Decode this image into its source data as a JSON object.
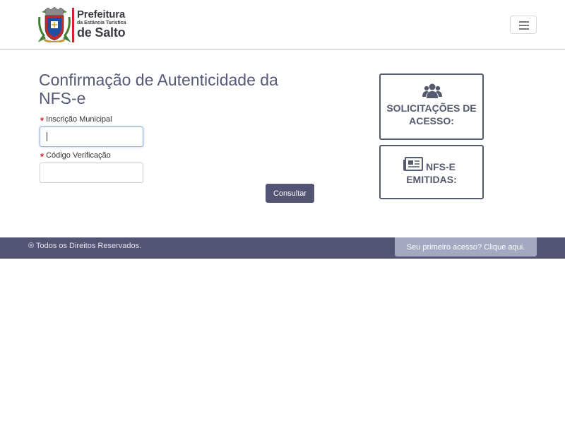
{
  "header": {
    "logo": {
      "line1": "Prefeitura",
      "line2": "da Estância Turística",
      "line3": "de Salto"
    },
    "menu_icon": "hamburger-menu-icon"
  },
  "main": {
    "title": "Confirmação de Autenticidade da NFS-e",
    "required_mark": "*",
    "inscricao": {
      "label": "Inscrição Municipal",
      "value": ""
    },
    "codigo": {
      "label": "Código Verificação",
      "value": ""
    },
    "submit_label": "Consultar"
  },
  "tiles": {
    "solicitacoes": {
      "icon": "users-icon",
      "label": "SOLICITAÇÕES DE ACESSO:"
    },
    "nfse": {
      "icon": "newspaper-icon",
      "label_part1": "NFS-E",
      "label_part2": "EMITIDAS:"
    }
  },
  "footer": {
    "copyright": "® Todos os Direitos Reservados.",
    "first_access_label": "Seu primeiro acesso? Clique aqui."
  },
  "colors": {
    "primary": "#535373",
    "title": "#565a78",
    "required": "#d2232a",
    "footer_button": "#a4a9c1"
  }
}
